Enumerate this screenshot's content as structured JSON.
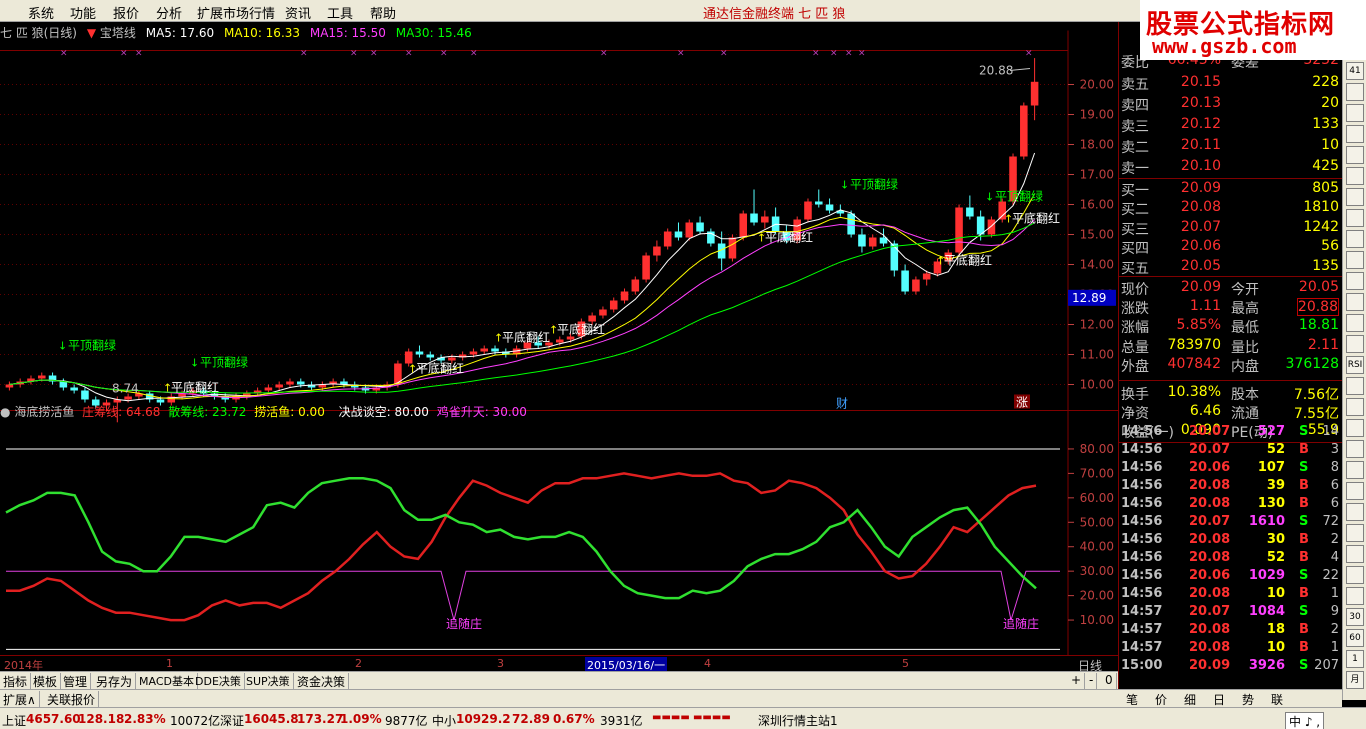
{
  "menu": [
    "系统",
    "功能",
    "报价",
    "分析",
    "扩展市场行情",
    "资讯",
    "工具",
    "帮助"
  ],
  "app_title": "通达信金融终端 七 匹 狼",
  "brand": {
    "line1": "股票公式指标网",
    "line2": "www.gszb.com"
  },
  "chart_header": {
    "name": "七 匹 狼(日线)",
    "indicator": "宝塔线",
    "ma5": "MA5: 17.60",
    "ma10": "MA10: 16.33",
    "ma15": "MA15: 15.50",
    "ma30": "MA30: 15.46"
  },
  "sub_header": {
    "name": "海底捞活鱼",
    "l1": "庄筹线: 64.68",
    "l2": "散筹线: 23.72",
    "l3": "捞活鱼: 0.00",
    "l4": "决战谈空: 80.00",
    "l5": "鸡雀升天: 30.00"
  },
  "price_axis": [
    "20.00",
    "19.00",
    "18.00",
    "17.00",
    "16.00",
    "15.00",
    "14.00",
    "13.00",
    "12.00",
    "11.00",
    "10.00"
  ],
  "current_price_tag": "12.89",
  "sub_axis": [
    "80.00",
    "70.00",
    "60.00",
    "50.00",
    "40.00",
    "30.00",
    "20.00",
    "10.00"
  ],
  "annotations": {
    "high": "20.88",
    "low": "8.74",
    "tops": [
      "平顶翻绿",
      "平顶翻绿",
      "平顶翻绿",
      "平顶翻绿"
    ],
    "bottoms": [
      "平底翻红",
      "平底翻红",
      "平底翻红",
      "平底翻红",
      "平底翻红",
      "平底翻红",
      "平底翻红"
    ],
    "zhui": [
      "追随庄",
      "追随庄"
    ],
    "cai": "财",
    "zhang": "涨"
  },
  "date_bar": {
    "year": "2014年",
    "m1": "1",
    "m2": "2",
    "m3": "3",
    "cursor": "2015/03/16/一",
    "m4": "4",
    "m5": "5",
    "period": "日线"
  },
  "tabs1": [
    "指标",
    "模板",
    "管理",
    "另存为",
    "MACD基本",
    "DDE决策",
    "SUP决策",
    "资金决策"
  ],
  "tabs1_right": [
    "+",
    "-",
    "0"
  ],
  "tabs2": [
    "扩展∧",
    "关联报价"
  ],
  "quote": {
    "weibi_label": "委比",
    "weibi": "66.43%",
    "weicha_label": "委差",
    "weicha": "3232",
    "sell": [
      {
        "label": "卖五",
        "price": "20.15",
        "vol": "228"
      },
      {
        "label": "卖四",
        "price": "20.13",
        "vol": "20"
      },
      {
        "label": "卖三",
        "price": "20.12",
        "vol": "133"
      },
      {
        "label": "卖二",
        "price": "20.11",
        "vol": "10"
      },
      {
        "label": "卖一",
        "price": "20.10",
        "vol": "425"
      }
    ],
    "buy": [
      {
        "label": "买一",
        "price": "20.09",
        "vol": "805"
      },
      {
        "label": "买二",
        "price": "20.08",
        "vol": "1810"
      },
      {
        "label": "买三",
        "price": "20.07",
        "vol": "1242"
      },
      {
        "label": "买四",
        "price": "20.06",
        "vol": "56"
      },
      {
        "label": "买五",
        "price": "20.05",
        "vol": "135"
      }
    ],
    "stats": [
      {
        "l1": "现价",
        "v1": "20.09",
        "l2": "今开",
        "v2": "20.05",
        "c1": "#ff3030",
        "c2": "#ff3030"
      },
      {
        "l1": "涨跌",
        "v1": "1.11",
        "l2": "最高",
        "v2": "20.88",
        "c1": "#ff3030",
        "c2": "#ff3030"
      },
      {
        "l1": "涨幅",
        "v1": "5.85%",
        "l2": "最低",
        "v2": "18.81",
        "c1": "#ff3030",
        "c2": "#00ff00"
      },
      {
        "l1": "总量",
        "v1": "783970",
        "l2": "量比",
        "v2": "2.11",
        "c1": "#ffff00",
        "c2": "#ff3030"
      },
      {
        "l1": "外盘",
        "v1": "407842",
        "l2": "内盘",
        "v2": "376128",
        "c1": "#ff3030",
        "c2": "#00ff00"
      },
      {
        "l1": "换手",
        "v1": "10.38%",
        "l2": "股本",
        "v2": "7.56亿",
        "c1": "#ffff00",
        "c2": "#ffff00"
      },
      {
        "l1": "净资",
        "v1": "6.46",
        "l2": "流通",
        "v2": "7.55亿",
        "c1": "#ffff00",
        "c2": "#ffff00"
      },
      {
        "l1": "收益(一)",
        "v1": "0.090",
        "l2": "PE(动)",
        "v2": "55.9",
        "c1": "#ffff00",
        "c2": "#ffff00"
      }
    ],
    "ticks": [
      {
        "t": "14:56",
        "p": "20.07",
        "v": "527",
        "s": "S",
        "n": "14",
        "vc": "#ff40ff"
      },
      {
        "t": "14:56",
        "p": "20.07",
        "v": "52",
        "s": "B",
        "n": "3",
        "vc": "#ffff00"
      },
      {
        "t": "14:56",
        "p": "20.06",
        "v": "107",
        "s": "S",
        "n": "8",
        "vc": "#ffff00"
      },
      {
        "t": "14:56",
        "p": "20.08",
        "v": "39",
        "s": "B",
        "n": "6",
        "vc": "#ffff00"
      },
      {
        "t": "14:56",
        "p": "20.08",
        "v": "130",
        "s": "B",
        "n": "6",
        "vc": "#ffff00"
      },
      {
        "t": "14:56",
        "p": "20.07",
        "v": "1610",
        "s": "S",
        "n": "72",
        "vc": "#ff40ff"
      },
      {
        "t": "14:56",
        "p": "20.08",
        "v": "30",
        "s": "B",
        "n": "2",
        "vc": "#ffff00"
      },
      {
        "t": "14:56",
        "p": "20.08",
        "v": "52",
        "s": "B",
        "n": "4",
        "vc": "#ffff00"
      },
      {
        "t": "14:56",
        "p": "20.06",
        "v": "1029",
        "s": "S",
        "n": "22",
        "vc": "#ff40ff"
      },
      {
        "t": "14:56",
        "p": "20.08",
        "v": "10",
        "s": "B",
        "n": "1",
        "vc": "#ffff00"
      },
      {
        "t": "14:57",
        "p": "20.07",
        "v": "1084",
        "s": "S",
        "n": "9",
        "vc": "#ff40ff"
      },
      {
        "t": "14:57",
        "p": "20.08",
        "v": "18",
        "s": "B",
        "n": "2",
        "vc": "#ffff00"
      },
      {
        "t": "14:57",
        "p": "20.08",
        "v": "10",
        "s": "B",
        "n": "1",
        "vc": "#ffff00"
      },
      {
        "t": "15:00",
        "p": "20.09",
        "v": "3926",
        "s": "S",
        "n": "207",
        "vc": "#ff40ff"
      }
    ]
  },
  "right_tabs": [
    "笔",
    "价",
    "细",
    "日",
    "势",
    "联"
  ],
  "right_toolbar": [
    "41",
    "",
    "",
    "",
    "",
    "",
    "",
    "",
    "",
    "",
    "",
    "",
    "",
    "",
    "RSI",
    "",
    "",
    "",
    "",
    "",
    "",
    "",
    "",
    "",
    "",
    "",
    "30",
    "60",
    "1",
    "月"
  ],
  "ime": "中 ♪ ,",
  "statusbar": {
    "sh": "上证",
    "sh_v": "4657.60",
    "sh_c": "128.18",
    "sh_p": "2.83%",
    "sh_a": "10072亿",
    "sz": "深证",
    "sz_v": "16045.8",
    "sz_c": "173.27",
    "sz_p": "1.09%",
    "sz_a": "9877亿",
    "zx": "中小",
    "zx_v": "10929.2",
    "zx_c": "72.89",
    "zx_p": "0.67%",
    "zx_a": "3931亿",
    "station": "深圳行情主站1"
  },
  "colors": {
    "up": "#ff3030",
    "down": "#54ffff",
    "ma5": "#ffffff",
    "ma10": "#ffff00",
    "ma15": "#ff40ff",
    "ma30": "#00ff00",
    "green_line": "#30e030",
    "red_line": "#e02020",
    "magenta_line": "#e040e0"
  },
  "chart_data": {
    "type": "candlestick",
    "x_ticks": [
      "2014年",
      "1",
      "2",
      "3",
      "4",
      "5"
    ],
    "y_ticks": [
      10,
      11,
      12,
      13,
      14,
      15,
      16,
      17,
      18,
      19,
      20
    ],
    "ylim": [
      9.2,
      21.2
    ],
    "ohlc": [
      [
        9.9,
        10.1,
        9.8,
        10.0
      ],
      [
        10.0,
        10.2,
        9.9,
        10.1
      ],
      [
        10.1,
        10.3,
        10.0,
        10.2
      ],
      [
        10.2,
        10.4,
        10.1,
        10.3
      ],
      [
        10.3,
        10.4,
        10.0,
        10.1
      ],
      [
        10.1,
        10.2,
        9.8,
        9.9
      ],
      [
        9.9,
        10.0,
        9.7,
        9.8
      ],
      [
        9.8,
        9.9,
        9.4,
        9.5
      ],
      [
        9.5,
        9.6,
        9.2,
        9.3
      ],
      [
        9.3,
        9.5,
        9.1,
        9.4
      ],
      [
        9.4,
        9.6,
        8.74,
        9.5
      ],
      [
        9.5,
        9.7,
        9.4,
        9.6
      ],
      [
        9.6,
        9.8,
        9.5,
        9.7
      ],
      [
        9.7,
        9.8,
        9.4,
        9.5
      ],
      [
        9.5,
        9.6,
        9.3,
        9.4
      ],
      [
        9.4,
        9.7,
        9.3,
        9.6
      ],
      [
        9.6,
        9.8,
        9.5,
        9.7
      ],
      [
        9.7,
        9.9,
        9.6,
        9.8
      ],
      [
        9.8,
        9.9,
        9.6,
        9.7
      ],
      [
        9.7,
        9.8,
        9.5,
        9.6
      ],
      [
        9.6,
        9.7,
        9.4,
        9.5
      ],
      [
        9.5,
        9.7,
        9.4,
        9.6
      ],
      [
        9.6,
        9.8,
        9.5,
        9.7
      ],
      [
        9.7,
        9.9,
        9.6,
        9.8
      ],
      [
        9.8,
        10.0,
        9.7,
        9.9
      ],
      [
        9.9,
        10.1,
        9.8,
        10.0
      ],
      [
        10.0,
        10.2,
        9.9,
        10.1
      ],
      [
        10.1,
        10.2,
        9.9,
        10.0
      ],
      [
        10.0,
        10.1,
        9.8,
        9.9
      ],
      [
        9.9,
        10.1,
        9.8,
        10.0
      ],
      [
        10.0,
        10.2,
        9.9,
        10.1
      ],
      [
        10.1,
        10.2,
        9.9,
        10.0
      ],
      [
        10.0,
        10.1,
        9.8,
        9.9
      ],
      [
        9.9,
        10.0,
        9.7,
        9.8
      ],
      [
        9.8,
        10.0,
        9.7,
        9.9
      ],
      [
        9.9,
        10.1,
        9.8,
        10.0
      ],
      [
        10.0,
        10.8,
        9.9,
        10.7
      ],
      [
        10.7,
        11.2,
        10.6,
        11.1
      ],
      [
        11.1,
        11.3,
        10.9,
        11.0
      ],
      [
        11.0,
        11.1,
        10.8,
        10.9
      ],
      [
        10.9,
        11.0,
        10.7,
        10.8
      ],
      [
        10.8,
        11.0,
        10.7,
        10.9
      ],
      [
        10.9,
        11.1,
        10.8,
        11.0
      ],
      [
        11.0,
        11.2,
        10.9,
        11.1
      ],
      [
        11.1,
        11.3,
        11.0,
        11.2
      ],
      [
        11.2,
        11.3,
        11.0,
        11.1
      ],
      [
        11.1,
        11.2,
        10.9,
        11.0
      ],
      [
        11.0,
        11.3,
        10.9,
        11.2
      ],
      [
        11.2,
        11.5,
        11.1,
        11.4
      ],
      [
        11.4,
        11.6,
        11.2,
        11.3
      ],
      [
        11.3,
        11.5,
        11.2,
        11.4
      ],
      [
        11.4,
        11.6,
        11.3,
        11.5
      ],
      [
        11.5,
        11.7,
        11.4,
        11.6
      ],
      [
        11.6,
        12.2,
        11.5,
        12.1
      ],
      [
        12.1,
        12.4,
        12.0,
        12.3
      ],
      [
        12.3,
        12.6,
        12.2,
        12.5
      ],
      [
        12.5,
        12.9,
        12.4,
        12.8
      ],
      [
        12.8,
        13.2,
        12.7,
        13.1
      ],
      [
        13.1,
        13.6,
        13.0,
        13.5
      ],
      [
        13.5,
        14.4,
        13.4,
        14.3
      ],
      [
        14.3,
        14.8,
        14.1,
        14.6
      ],
      [
        14.6,
        15.2,
        14.5,
        15.1
      ],
      [
        15.1,
        15.4,
        14.8,
        14.9
      ],
      [
        14.9,
        15.5,
        14.8,
        15.4
      ],
      [
        15.4,
        15.6,
        15.0,
        15.1
      ],
      [
        15.1,
        15.2,
        14.6,
        14.7
      ],
      [
        14.7,
        15.1,
        13.8,
        14.2
      ],
      [
        14.2,
        15.0,
        14.1,
        14.9
      ],
      [
        14.9,
        15.8,
        14.8,
        15.7
      ],
      [
        15.7,
        16.5,
        15.3,
        15.4
      ],
      [
        15.4,
        15.8,
        15.2,
        15.6
      ],
      [
        15.6,
        15.9,
        15.0,
        15.1
      ],
      [
        15.1,
        15.3,
        14.7,
        14.8
      ],
      [
        14.8,
        15.6,
        14.7,
        15.5
      ],
      [
        15.5,
        16.2,
        15.4,
        16.1
      ],
      [
        16.1,
        16.5,
        15.9,
        16.0
      ],
      [
        16.0,
        16.2,
        15.7,
        15.8
      ],
      [
        15.8,
        16.0,
        15.6,
        15.7
      ],
      [
        15.7,
        15.8,
        14.9,
        15.0
      ],
      [
        15.0,
        15.2,
        14.4,
        14.6
      ],
      [
        14.6,
        15.0,
        14.5,
        14.9
      ],
      [
        14.9,
        15.2,
        14.6,
        14.7
      ],
      [
        14.7,
        14.8,
        13.6,
        13.8
      ],
      [
        13.8,
        14.0,
        13.0,
        13.1
      ],
      [
        13.1,
        13.6,
        13.0,
        13.5
      ],
      [
        13.5,
        13.8,
        13.3,
        13.7
      ],
      [
        13.7,
        14.2,
        13.6,
        14.1
      ],
      [
        14.1,
        14.5,
        14.0,
        14.4
      ],
      [
        14.4,
        16.0,
        14.3,
        15.9
      ],
      [
        15.9,
        16.3,
        15.5,
        15.6
      ],
      [
        15.6,
        15.8,
        14.8,
        15.0
      ],
      [
        15.0,
        15.6,
        14.9,
        15.5
      ],
      [
        15.5,
        16.2,
        15.4,
        16.1
      ],
      [
        16.1,
        17.7,
        16.0,
        17.6
      ],
      [
        17.6,
        19.4,
        17.5,
        19.3
      ],
      [
        19.3,
        20.88,
        18.81,
        20.09
      ]
    ],
    "sub": {
      "series": [
        {
          "name": "庄筹线",
          "values": [
            22,
            22,
            24,
            27,
            26,
            22,
            18,
            15,
            13,
            13,
            12,
            11,
            10,
            10,
            12,
            16,
            18,
            16,
            17,
            17,
            15,
            18,
            21,
            26,
            30,
            35,
            41,
            46,
            40,
            36,
            35,
            42,
            52,
            60,
            67,
            65,
            62,
            60,
            58,
            63,
            66,
            66,
            68,
            68,
            69,
            70,
            69,
            68,
            69,
            70,
            69,
            69,
            70,
            67,
            66,
            62,
            63,
            67,
            66,
            64,
            60,
            55,
            45,
            38,
            30,
            27,
            28,
            33,
            40,
            48,
            46,
            51,
            56,
            61,
            64,
            65
          ]
        },
        {
          "name": "散筹线",
          "values": [
            54,
            57,
            59,
            62,
            62,
            61,
            50,
            38,
            34,
            33,
            30,
            30,
            36,
            44,
            44,
            43,
            42,
            45,
            48,
            57,
            58,
            56,
            62,
            66,
            67,
            68,
            68,
            67,
            64,
            55,
            51,
            51,
            53,
            50,
            49,
            46,
            47,
            44,
            43,
            44,
            44,
            46,
            44,
            38,
            30,
            24,
            21,
            20,
            19,
            19,
            22,
            21,
            22,
            26,
            32,
            35,
            37,
            37,
            39,
            42,
            48,
            50,
            55,
            48,
            40,
            36,
            44,
            48,
            52,
            55,
            56,
            49,
            40,
            34,
            28,
            23
          ]
        }
      ],
      "flat_level": 30,
      "dips": [
        {
          "index": 37,
          "value": 10
        },
        {
          "index": 115,
          "value": 10
        }
      ]
    }
  }
}
